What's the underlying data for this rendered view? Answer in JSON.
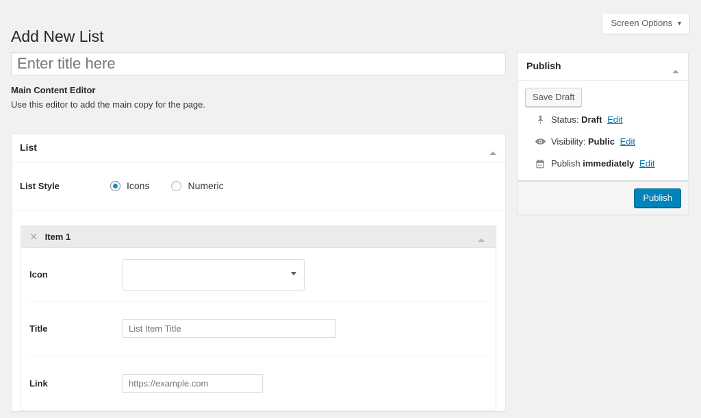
{
  "screen_meta": {
    "screen_options_label": "Screen Options",
    "caret": "▼"
  },
  "page": {
    "title": "Add New List"
  },
  "title_field": {
    "placeholder": "Enter title here",
    "value": ""
  },
  "editor_note": {
    "title": "Main Content Editor",
    "description": "Use this editor to add the main copy for the page."
  },
  "list_box": {
    "heading": "List",
    "toggle_icon": "chevron-up-icon",
    "list_style": {
      "label": "List Style",
      "options": [
        {
          "label": "Icons",
          "checked": true
        },
        {
          "label": "Numeric",
          "checked": false
        }
      ]
    },
    "items": [
      {
        "title": "Item 1",
        "remove_icon": "×",
        "toggle_icon": "chevron-up-icon",
        "fields": {
          "icon": {
            "label": "Icon",
            "selected": "",
            "caret": "chevron-down-icon"
          },
          "title": {
            "label": "Title",
            "placeholder": "List Item Title",
            "value": ""
          },
          "link": {
            "label": "Link",
            "placeholder": "https://example.com",
            "value": ""
          }
        }
      }
    ]
  },
  "publish_box": {
    "heading": "Publish",
    "toggle_icon": "chevron-up-icon",
    "save_draft_label": "Save Draft",
    "status": {
      "icon": "post-status-pin-icon",
      "prefix": "Status:",
      "value": "Draft",
      "edit_label": "Edit"
    },
    "visibility": {
      "icon": "visibility-eye-icon",
      "prefix": "Visibility:",
      "value": "Public",
      "edit_label": "Edit"
    },
    "schedule": {
      "icon": "calendar-icon",
      "prefix": "Publish",
      "value": "immediately",
      "edit_label": "Edit"
    },
    "publish_label": "Publish"
  },
  "colors": {
    "page_background": "#f1f1f1",
    "primary_button": "#0085ba",
    "link": "#0073aa",
    "radio_accent": "#1e8cbe",
    "item_header": "#ebebeb"
  }
}
